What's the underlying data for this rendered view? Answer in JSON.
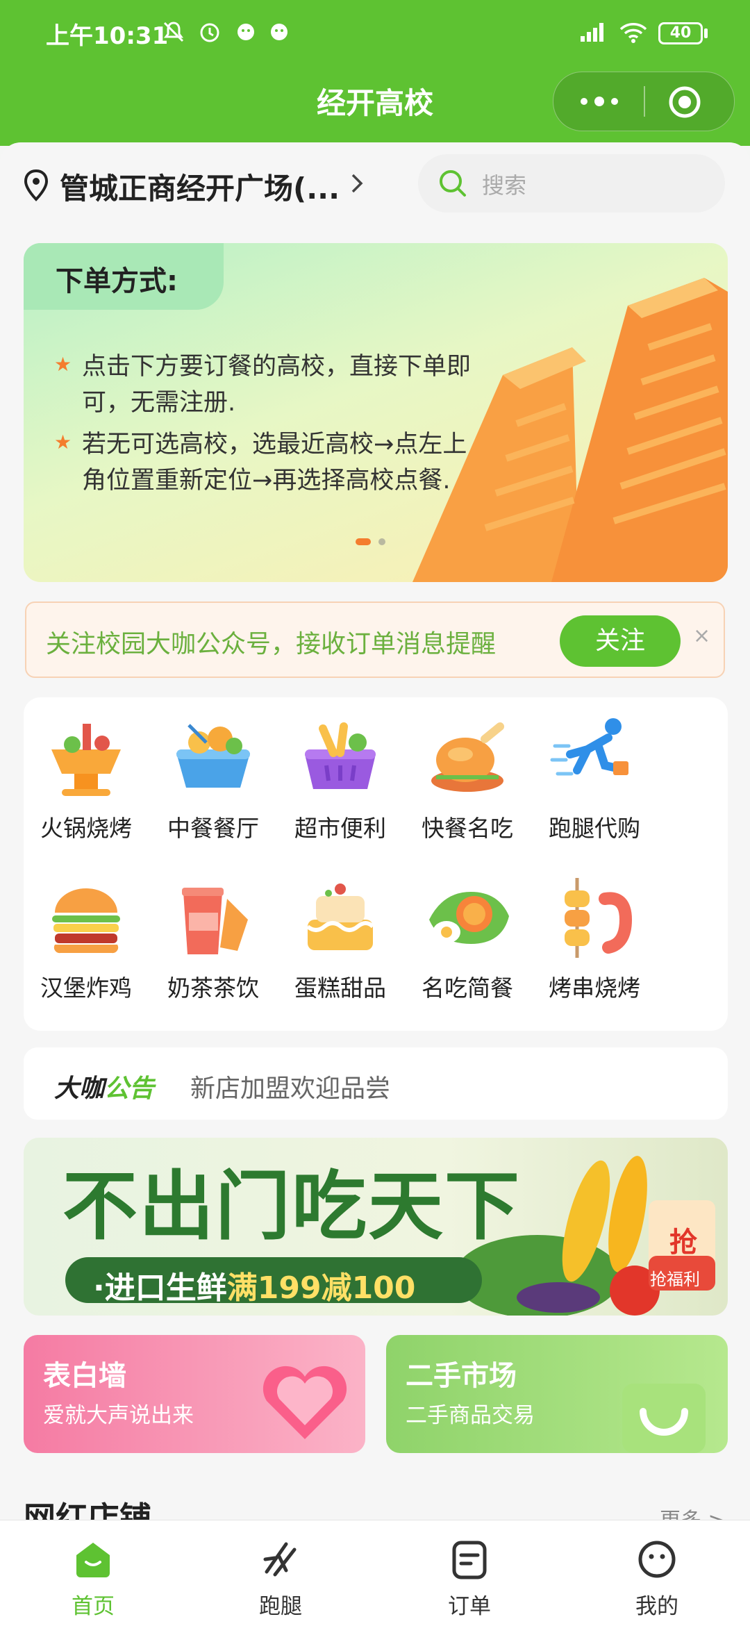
{
  "status_bar": {
    "time": "上午10:31",
    "battery": "40"
  },
  "header": {
    "title": "经开高校"
  },
  "location": {
    "text": "管城正商经开广场(..."
  },
  "search": {
    "placeholder": "搜索"
  },
  "banner": {
    "title": "下单方式:",
    "lines": [
      "点击下方要订餐的高校，直接下单即",
      "可，无需注册.",
      "若无可选高校，选最近高校→点左上",
      "角位置重新定位→再选择高校点餐."
    ]
  },
  "follow_bar": {
    "text": "关注校园大咖公众号，接收订单消息提醒",
    "button": "关注",
    "close": "×"
  },
  "categories": [
    {
      "label": "火锅烧烤",
      "icon": "hotpot-icon"
    },
    {
      "label": "中餐餐厅",
      "icon": "chinese-food-icon"
    },
    {
      "label": "超市便利",
      "icon": "supermarket-basket-icon"
    },
    {
      "label": "快餐名吃",
      "icon": "roast-chicken-icon"
    },
    {
      "label": "跑腿代购",
      "icon": "runner-icon"
    },
    {
      "label": "汉堡炸鸡",
      "icon": "burger-icon"
    },
    {
      "label": "奶茶茶饮",
      "icon": "milk-tea-icon"
    },
    {
      "label": "蛋糕甜品",
      "icon": "cake-icon"
    },
    {
      "label": "名吃简餐",
      "icon": "egg-meal-icon"
    },
    {
      "label": "烤串烧烤",
      "icon": "skewer-icon"
    }
  ],
  "notice": {
    "logo_a": "大咖",
    "logo_b": "公告",
    "text": "新店加盟欢迎品尝"
  },
  "promo": {
    "headline": "不出门吃天下",
    "sub_a": "·进口生鲜",
    "sub_b": "满199减100",
    "badge": "抢",
    "badge_sub": "抢福利"
  },
  "cards": [
    {
      "title": "表白墙",
      "sub": "爱就大声说出来",
      "color": "#f57ba3"
    },
    {
      "title": "二手市场",
      "sub": "二手商品交易",
      "color": "#8fd36a"
    }
  ],
  "section": {
    "title": "网红店铺",
    "more": "更多 >"
  },
  "tabbar": [
    {
      "label": "首页",
      "icon": "home-icon",
      "active": true
    },
    {
      "label": "跑腿",
      "icon": "errand-icon"
    },
    {
      "label": "订单",
      "icon": "order-icon"
    },
    {
      "label": "我的",
      "icon": "profile-icon"
    }
  ],
  "colors": {
    "primary": "#5ec232",
    "accent_orange": "#f47d2e",
    "follow_text": "#6bb03e"
  }
}
